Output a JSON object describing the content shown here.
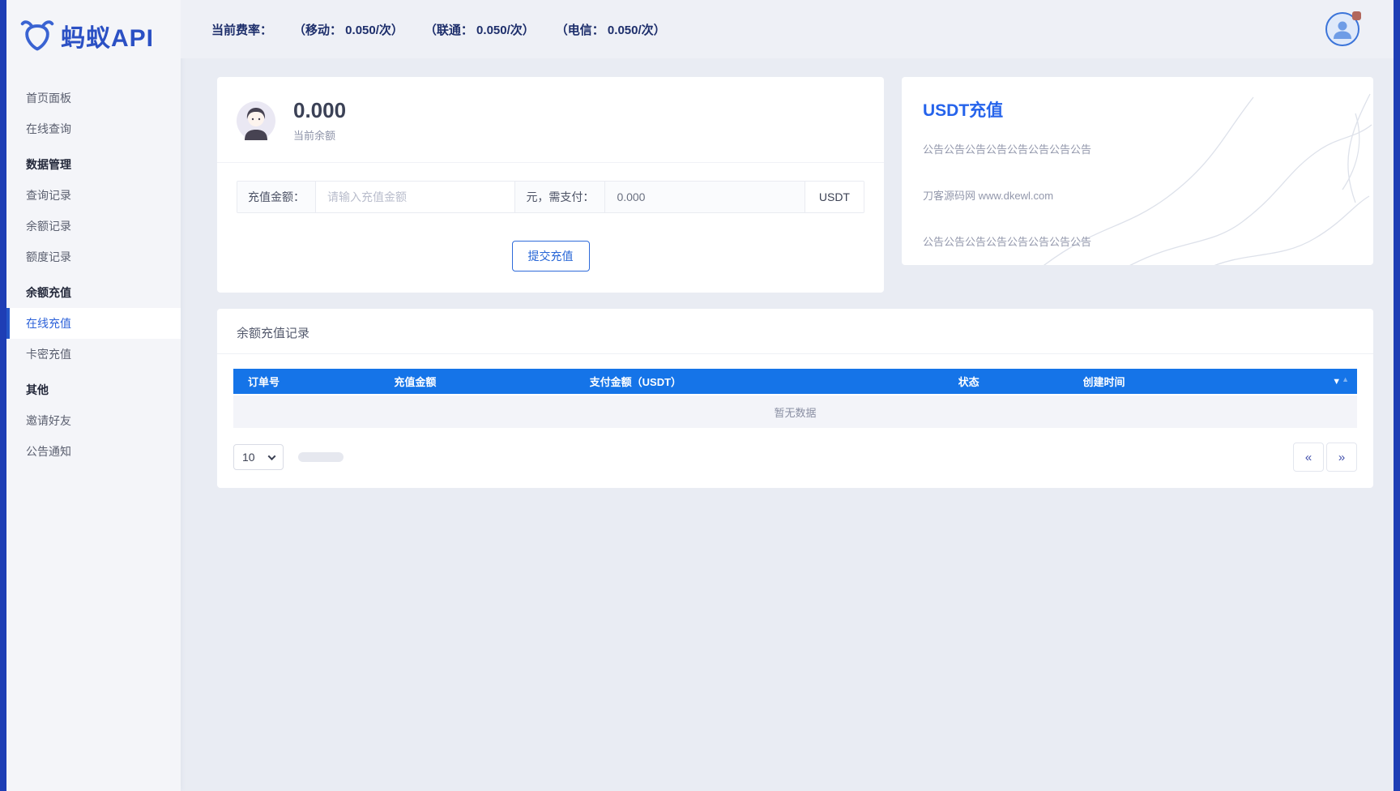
{
  "brand": {
    "name": "蚂蚁API"
  },
  "topbar": {
    "rate_label": "当前费率：",
    "rates": [
      "（移动： 0.050/次）",
      "（联通： 0.050/次）",
      "（电信： 0.050/次）"
    ],
    "avatar_icon": "user-silhouette-icon",
    "notification_dot_color": "#b2675c"
  },
  "sidebar": {
    "items": [
      {
        "label": "首页面板",
        "type": "link"
      },
      {
        "label": "在线查询",
        "type": "link"
      },
      {
        "label": "数据管理",
        "type": "header"
      },
      {
        "label": "查询记录",
        "type": "link"
      },
      {
        "label": "余额记录",
        "type": "link"
      },
      {
        "label": "额度记录",
        "type": "link"
      },
      {
        "label": "余额充值",
        "type": "header"
      },
      {
        "label": "在线充值",
        "type": "link",
        "active": true
      },
      {
        "label": "卡密充值",
        "type": "link"
      },
      {
        "label": "其他",
        "type": "header"
      },
      {
        "label": "邀请好友",
        "type": "link"
      },
      {
        "label": "公告通知",
        "type": "link"
      }
    ]
  },
  "balance": {
    "amount": "0.000",
    "label": "当前余额"
  },
  "recharge_form": {
    "amount_label": "充值金额：",
    "amount_placeholder": "请输入充值金额",
    "pay_label": "元，需支付：",
    "pay_value": "0.000",
    "currency": "USDT",
    "submit_label": "提交充值"
  },
  "notice": {
    "title": "USDT充值",
    "lines": [
      "公告公告公告公告公告公告公告公告",
      "刀客源码网 www.dkewl.com",
      "公告公告公告公告公告公告公告公告"
    ]
  },
  "records": {
    "title": "余额充值记录",
    "columns": [
      "订单号",
      "充值金额",
      "支付金额（USDT）",
      "状态",
      "创建时间"
    ],
    "sort_icon": {
      "down": "▼",
      "up": "▲"
    },
    "empty_text": "暂无数据",
    "page_size": "10",
    "pagination": {
      "prev": "«",
      "next": "»"
    }
  },
  "colors": {
    "accent_blue": "#2456c8",
    "table_header_blue": "#1574e8",
    "edge_strip_blue": "#1e3eb5",
    "notice_title_blue": "#2563eb"
  }
}
